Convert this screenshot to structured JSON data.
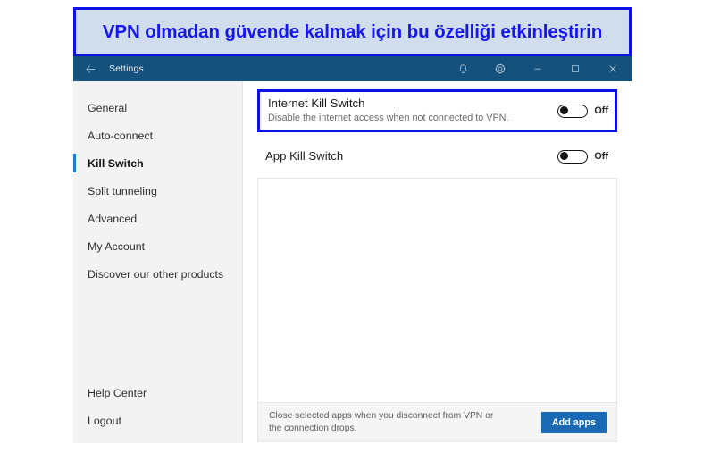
{
  "annotation": {
    "text": "VPN olmadan güvende kalmak için bu özelliği etkinleştirin",
    "border_color": "#0f0fe8",
    "fill_color": "#cfdded",
    "text_color": "#1616f0"
  },
  "title_bar": {
    "title": "Settings",
    "back_icon": "back-arrow-icon",
    "background_color": "#15517d",
    "actions": [
      {
        "name": "notifications",
        "icon": "bell-icon"
      },
      {
        "name": "settings",
        "icon": "gear-icon"
      },
      {
        "name": "minimize",
        "icon": "minimize-icon"
      },
      {
        "name": "maximize",
        "icon": "maximize-icon"
      },
      {
        "name": "close",
        "icon": "close-icon"
      }
    ]
  },
  "sidebar": {
    "items": [
      {
        "label": "General",
        "key": "general",
        "selected": false
      },
      {
        "label": "Auto-connect",
        "key": "auto-connect",
        "selected": false
      },
      {
        "label": "Kill Switch",
        "key": "kill-switch",
        "selected": true
      },
      {
        "label": "Split tunneling",
        "key": "split-tunneling",
        "selected": false
      },
      {
        "label": "Advanced",
        "key": "advanced",
        "selected": false
      },
      {
        "label": "My Account",
        "key": "my-account",
        "selected": false
      },
      {
        "label": "Discover our other products",
        "key": "discover-products",
        "selected": false
      }
    ],
    "bottom_items": [
      {
        "label": "Help Center",
        "key": "help-center"
      },
      {
        "label": "Logout",
        "key": "logout"
      }
    ],
    "accent_color": "#1a7fd4"
  },
  "main": {
    "internet_kill_switch": {
      "title": "Internet Kill Switch",
      "description": "Disable the internet access when not connected to VPN.",
      "toggle_state": "Off",
      "highlighted": true
    },
    "app_kill_switch": {
      "title": "App Kill Switch",
      "toggle_state": "Off"
    },
    "app_list": {
      "items": [],
      "footer_text": "Close selected apps when you disconnect from VPN or the connection drops.",
      "add_button_label": "Add apps",
      "add_button_color": "#1b69b5"
    }
  }
}
